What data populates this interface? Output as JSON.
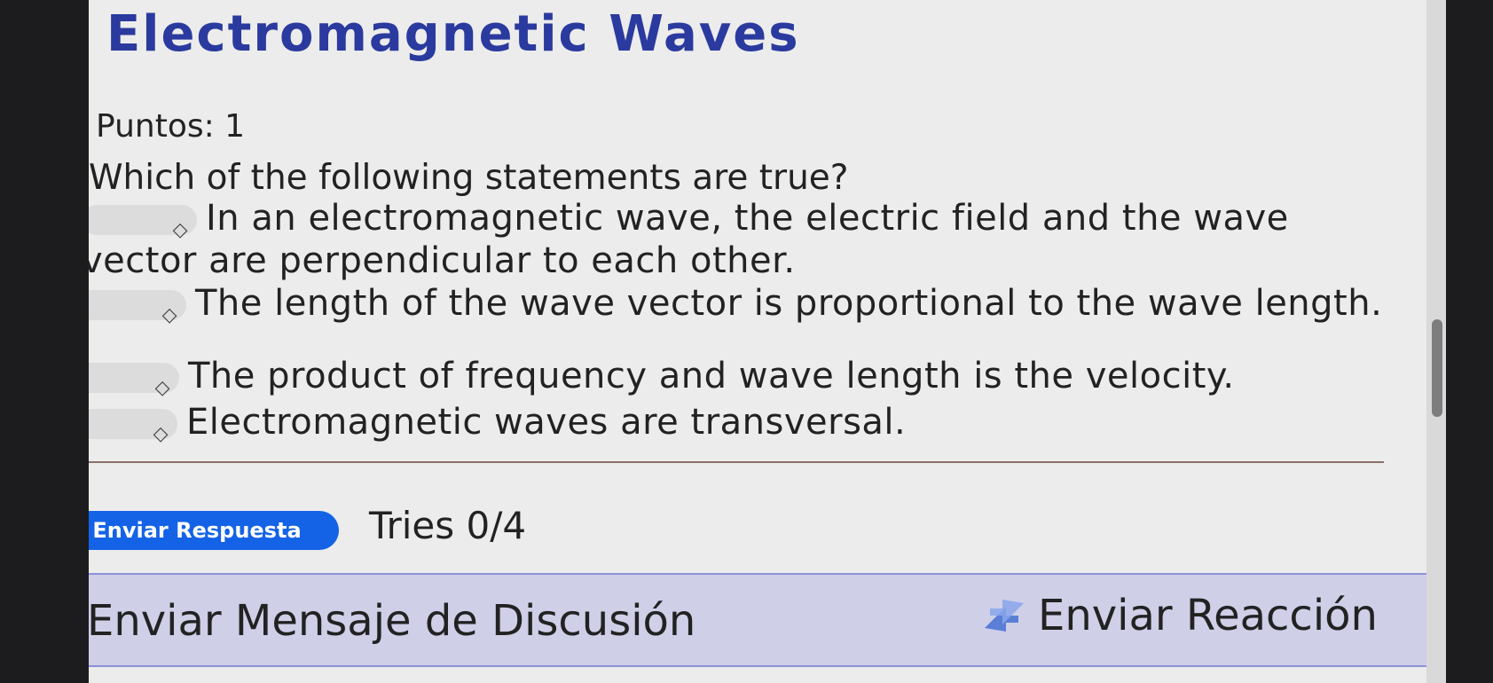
{
  "page": {
    "title": "Electromagnetic Waves",
    "points": "Puntos: 1",
    "question": "Which of the following statements are true?"
  },
  "statements": [
    {
      "text": "In an electromagnetic wave, the electric field and the wave vector are perpendicular to each other."
    },
    {
      "text": "The length of the wave vector is proportional to the wave length."
    },
    {
      "text": "The product of frequency and wave length is the velocity."
    },
    {
      "text": "Electromagnetic waves are transversal."
    }
  ],
  "actions": {
    "submit_label": "Enviar Respuesta",
    "tries": "Tries 0/4",
    "discuss_label": "Enviar Mensaje de Discusión",
    "react_label": "Enviar Reacción"
  },
  "icons": {
    "select_chevron": "chevron-updown-icon",
    "discuss": "speech-bubble-icon",
    "react": "arrows-icon"
  },
  "colors": {
    "title": "#2a3a9e",
    "submit_button": "#1463e6",
    "bottom_bar": "#cfcfe8"
  }
}
